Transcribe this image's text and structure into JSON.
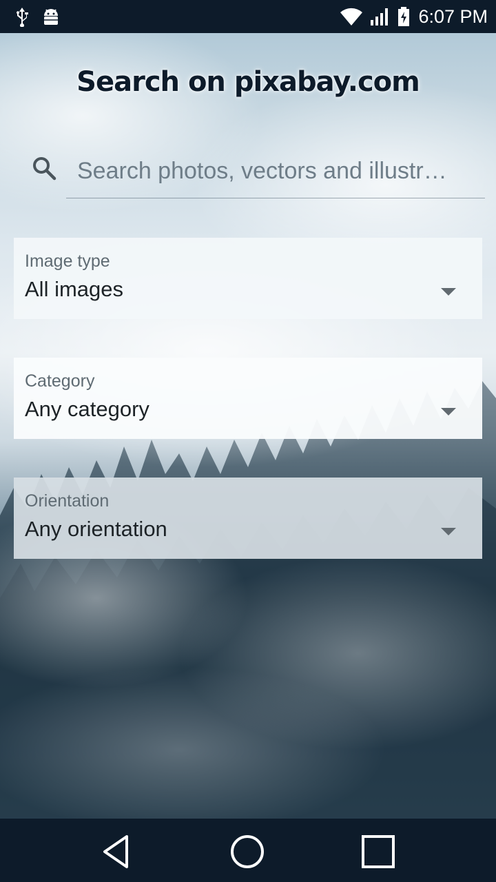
{
  "status_bar": {
    "time": "6:07 PM",
    "left_icons": [
      "usb-icon",
      "android-debug-icon"
    ],
    "right_icons": [
      "wifi-icon",
      "signal-icon",
      "battery-charging-icon"
    ]
  },
  "header": {
    "title": "Search on pixabay.com"
  },
  "search": {
    "placeholder": "Search photos, vectors and illustr…",
    "value": "",
    "icon": "search-icon"
  },
  "filters": [
    {
      "label": "Image type",
      "value": "All images"
    },
    {
      "label": "Category",
      "value": "Any category"
    },
    {
      "label": "Orientation",
      "value": "Any orientation"
    }
  ],
  "nav_bar": {
    "buttons": [
      "back-icon",
      "home-icon",
      "recents-icon"
    ]
  },
  "colors": {
    "status_bar_bg": "#0d1b2a",
    "title_color": "#0d1b2a",
    "label_color": "#5f6b73",
    "value_color": "#1d2327"
  }
}
